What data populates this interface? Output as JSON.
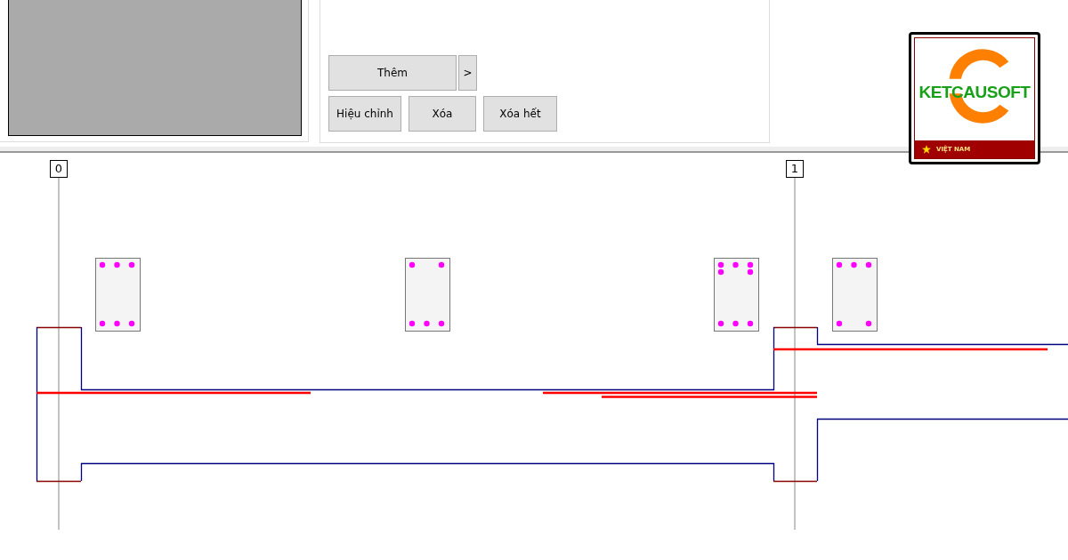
{
  "buttons_row_1": [
    {
      "label": "Thêm",
      "kind": "wide"
    },
    {
      "label": ">",
      "kind": "narrow"
    }
  ],
  "buttons_row_2": [
    {
      "label": "Hiệu chỉnh"
    },
    {
      "label": "Xóa"
    },
    {
      "label": "Xóa hết"
    }
  ],
  "logo": {
    "name": "KETCAUSOFT",
    "country": "VIỆT NAM"
  },
  "axes": [
    {
      "label": "0"
    },
    {
      "label": "1"
    }
  ]
}
